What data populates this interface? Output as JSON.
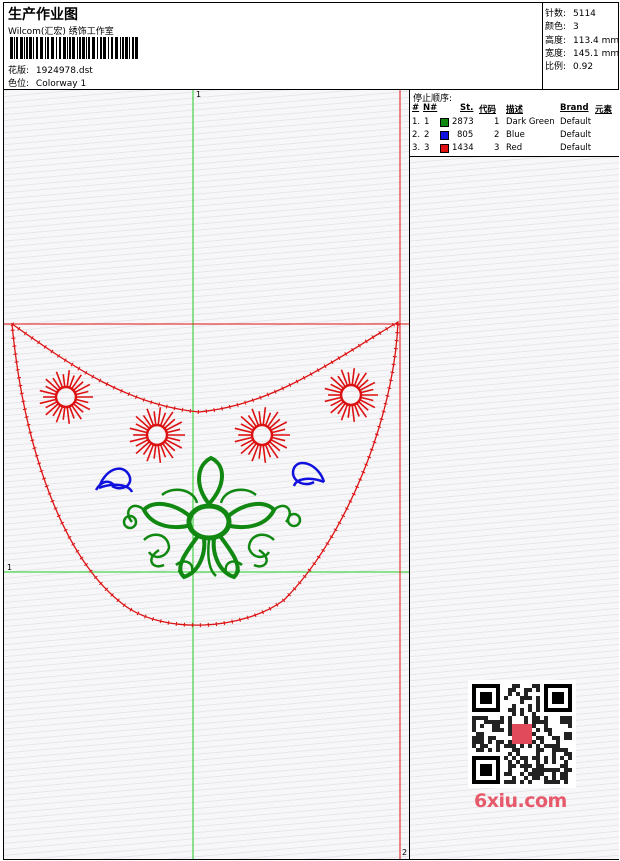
{
  "header": {
    "title": "生产作业图",
    "company": "Wilcom(汇宏) 绣饰工作室",
    "design_label": "花版:",
    "design_file": "1924978.dst",
    "colorway_label": "色位:",
    "colorway": "Colorway 1"
  },
  "stats": [
    {
      "label": "针数:",
      "value": "5114"
    },
    {
      "label": "颜色:",
      "value": "3"
    },
    {
      "label": "高度:",
      "value": "113.4 mm"
    },
    {
      "label": "宽度:",
      "value": "145.1 mm"
    },
    {
      "label": "比例:",
      "value": "0.92"
    }
  ],
  "stop_sequence": {
    "title": "停止顺序:",
    "columns": [
      "#",
      "N#",
      "St.",
      "代码",
      "描述",
      "Brand",
      "元素"
    ],
    "rows": [
      {
        "num": "1.",
        "n": "1",
        "color": "#118811",
        "st": "2873",
        "code": "1",
        "desc": "Dark Green",
        "brand": "Default"
      },
      {
        "num": "2.",
        "n": "2",
        "color": "#1111dd",
        "st": "805",
        "code": "2",
        "desc": "Blue",
        "brand": "Default"
      },
      {
        "num": "3.",
        "n": "3",
        "color": "#dd1111",
        "st": "1434",
        "code": "3",
        "desc": "Red",
        "brand": "Default"
      }
    ]
  },
  "axes": {
    "top_marker": "1",
    "left_marker": "1",
    "bottom_marker": "2"
  },
  "watermark": {
    "logo_text": "6xiu.com"
  },
  "colors": {
    "guide_green": "#22cc22",
    "guide_red": "#dd1111",
    "dark_green": "#118811",
    "blue": "#1111dd",
    "red": "#dd1111"
  }
}
